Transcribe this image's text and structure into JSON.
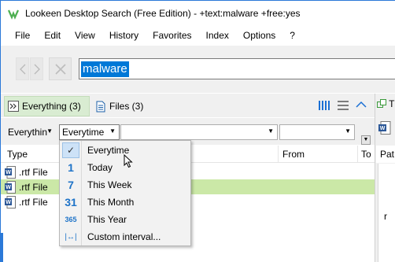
{
  "window": {
    "title": "Lookeen Desktop Search (Free Edition) - +text:malware +free:yes",
    "accent_color": "#2b79d8"
  },
  "menu": {
    "items": [
      "File",
      "Edit",
      "View",
      "History",
      "Favorites",
      "Index",
      "Options",
      "?"
    ]
  },
  "search": {
    "query": "malware",
    "back_icon": "chevron-left-icon",
    "forward_icon": "chevron-right-icon",
    "clear_icon": "close-icon"
  },
  "tabs": {
    "everything": {
      "label": "Everything (3)",
      "icon": "expand-arrows-icon"
    },
    "files": {
      "label": "Files (3)",
      "icon": "document-icon"
    }
  },
  "toolbar_right": {
    "icons": [
      "column-view-icon",
      "list-view-icon",
      "collapse-up-icon"
    ]
  },
  "filters": {
    "category": "Everythin",
    "date": "Everytime",
    "filter3": "",
    "filter4": ""
  },
  "grid": {
    "columns": [
      "Type",
      "From",
      "To"
    ],
    "rows": [
      {
        "type": ".rtf File",
        "selected": false
      },
      {
        "type": ".rtf File",
        "selected": true
      },
      {
        "type": ".rtf File",
        "selected": false
      }
    ],
    "selected_color": "#cbe8a7"
  },
  "date_dropdown": {
    "items": [
      {
        "label": "Everytime",
        "icon": "checkmark-icon",
        "glyph": "✓",
        "checked": true
      },
      {
        "label": "Today",
        "icon": "calendar-day-icon",
        "glyph": "1",
        "checked": false
      },
      {
        "label": "This Week",
        "icon": "calendar-week-icon",
        "glyph": "7",
        "checked": false
      },
      {
        "label": "This Month",
        "icon": "calendar-month-icon",
        "glyph": "31",
        "checked": false
      },
      {
        "label": "This Year",
        "icon": "calendar-year-icon",
        "glyph": "365",
        "checked": false
      },
      {
        "label": "Custom interval...",
        "icon": "interval-icon",
        "glyph": "|↔|",
        "checked": false
      }
    ]
  },
  "right_pane": {
    "tab_label": "T",
    "column_label": "Pat",
    "text_fragment": "r"
  }
}
